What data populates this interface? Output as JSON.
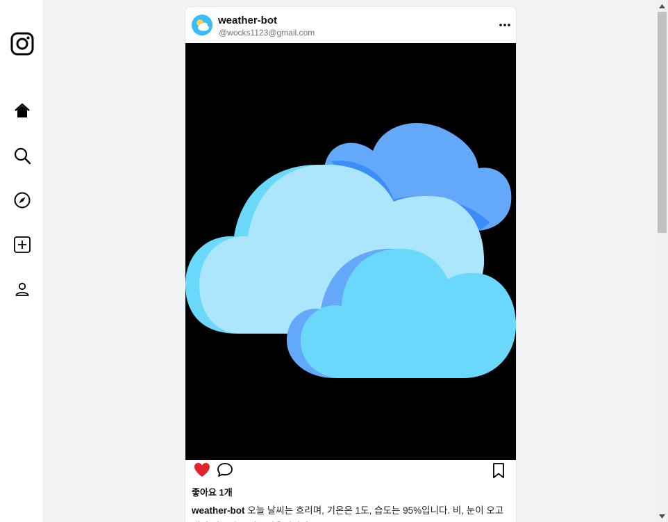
{
  "sidebar": {
    "items": [
      {
        "name": "instagram-logo-icon"
      },
      {
        "name": "home-icon"
      },
      {
        "name": "search-icon"
      },
      {
        "name": "explore-compass-icon"
      },
      {
        "name": "create-post-icon"
      },
      {
        "name": "profile-icon"
      }
    ]
  },
  "post": {
    "username": "weather-bot",
    "email": "@wocks1123@gmail.com",
    "likes_label": "좋아요 1개",
    "caption_user": "weather-bot",
    "caption_text": "오늘 날씨는 흐리며, 기온은 1도, 습도는 95%입니다. 비, 눈이 오고 예상 강수량은 강수없음입니다.",
    "liked": true,
    "icons": {
      "more": "more-dots-icon",
      "like": "heart-icon",
      "comment": "comment-icon",
      "save": "bookmark-icon"
    }
  },
  "colors": {
    "like_red": "#e0242c",
    "cloud_light": "#abe6fc",
    "cloud_cyan": "#6ad8fb",
    "cloud_blue": "#64a8fa",
    "cloud_shadow": "#3b8dfa",
    "image_bg": "#000000"
  }
}
